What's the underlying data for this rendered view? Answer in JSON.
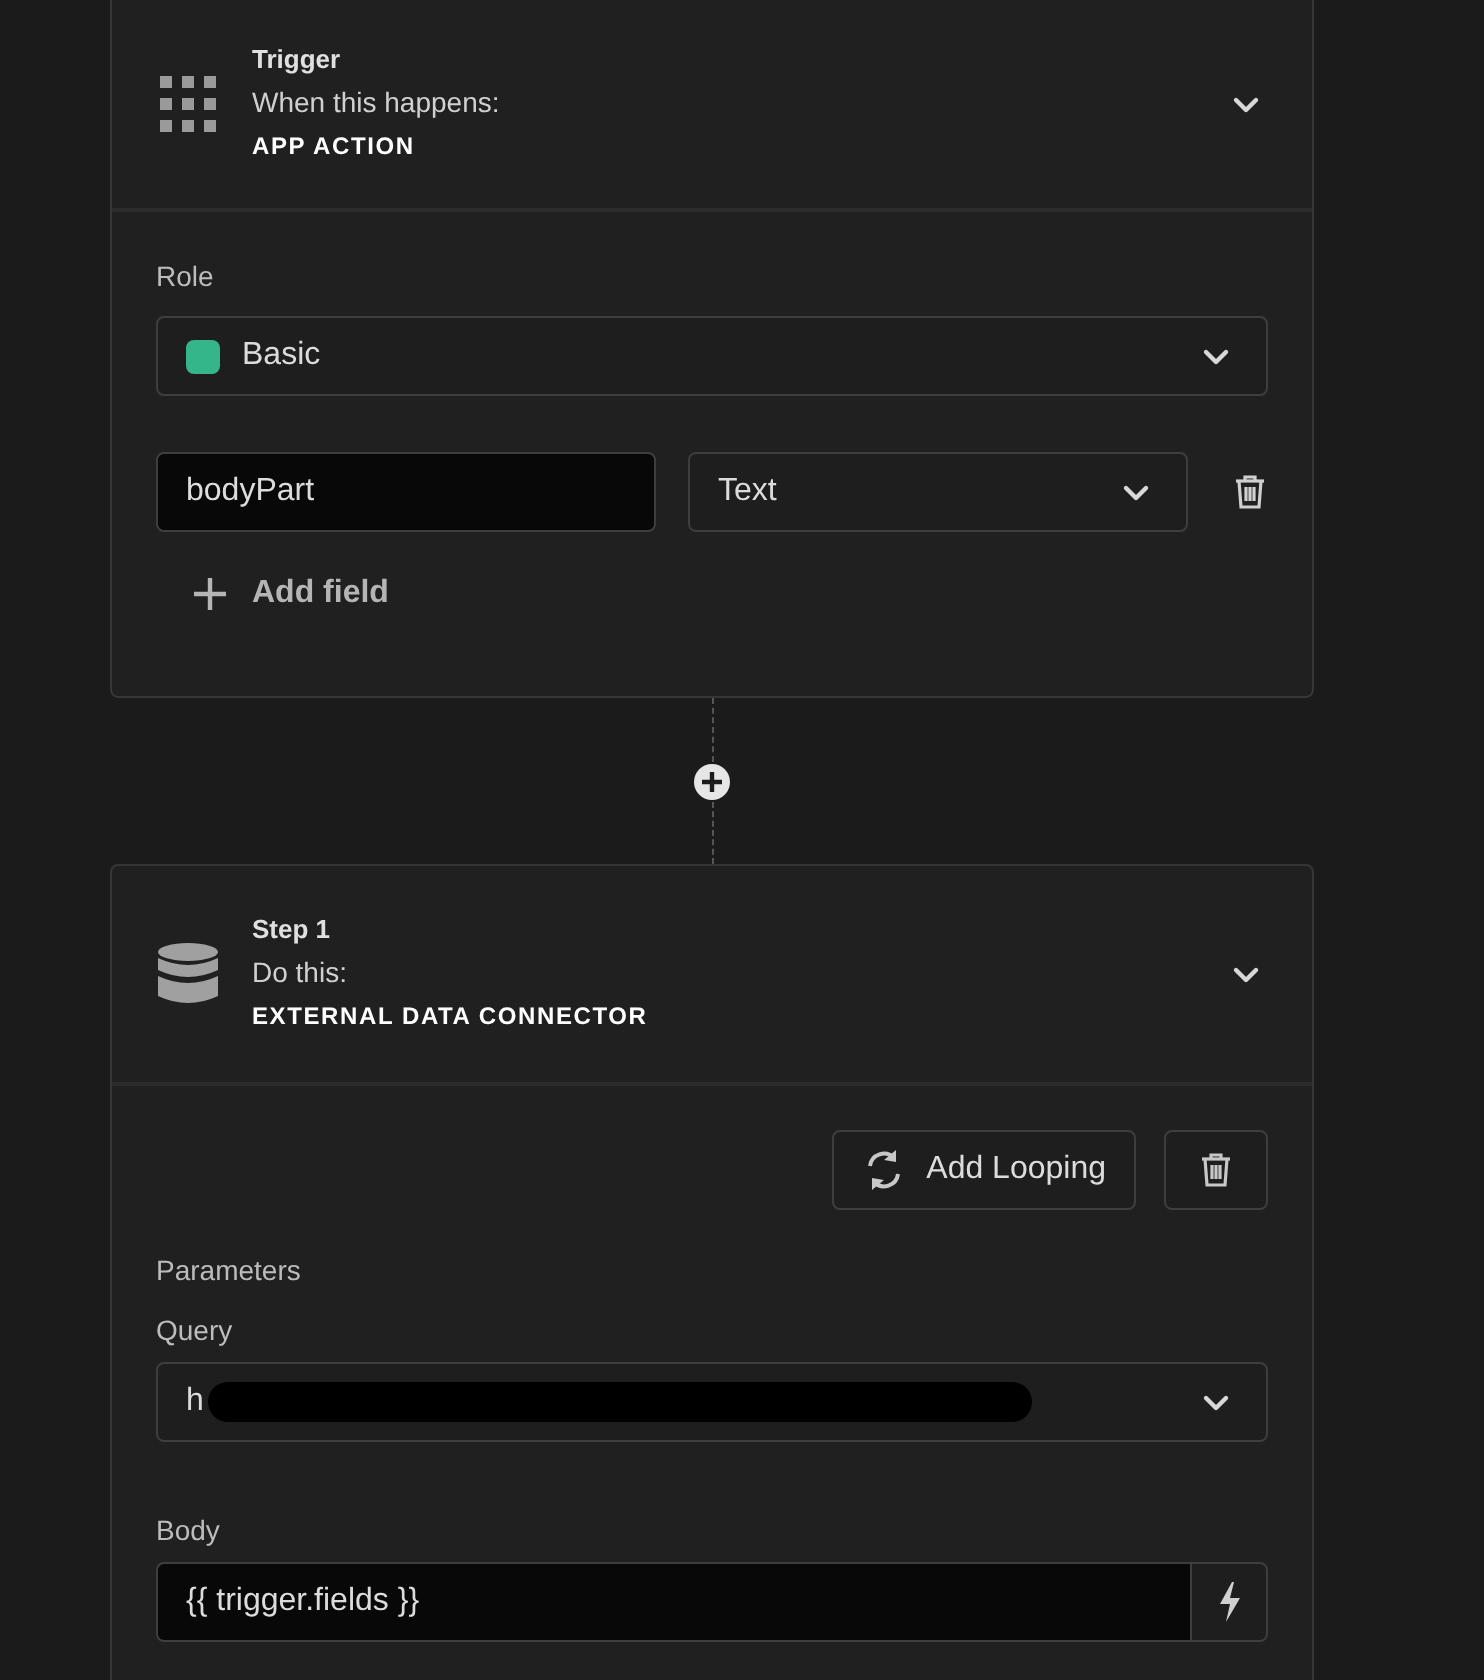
{
  "trigger": {
    "title": "Trigger",
    "subtitle": "When this happens:",
    "action": "APP ACTION",
    "role": {
      "label": "Role",
      "value": "Basic",
      "color": "#35b58a"
    },
    "fields": [
      {
        "name": "bodyPart",
        "type": "Text"
      }
    ],
    "add_field": "Add field"
  },
  "step": {
    "title": "Step 1",
    "subtitle": "Do this:",
    "action": "EXTERNAL DATA CONNECTOR",
    "add_looping": "Add Looping",
    "parameters_label": "Parameters",
    "query": {
      "label": "Query",
      "value": "h"
    },
    "body": {
      "label": "Body",
      "value": "{{ trigger.fields }}"
    }
  }
}
